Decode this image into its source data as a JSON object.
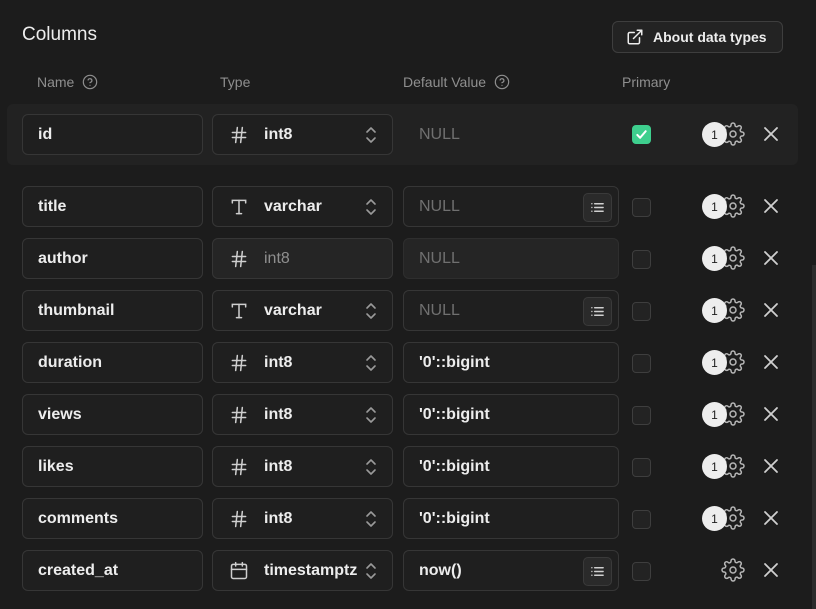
{
  "section": {
    "title": "Columns",
    "about_label": "About data types"
  },
  "headers": {
    "name": "Name",
    "type": "Type",
    "default": "Default Value",
    "primary": "Primary"
  },
  "rows": [
    {
      "name": "id",
      "type_icon": "hash-icon",
      "type": "int8",
      "selectable": true,
      "default": "NULL",
      "default_placeholder": true,
      "default_style": "plain",
      "has_list": false,
      "primary": true,
      "badge": "1"
    },
    {
      "name": "title",
      "type_icon": "text-icon",
      "type": "varchar",
      "selectable": true,
      "default": "NULL",
      "default_placeholder": true,
      "default_style": "field",
      "has_list": true,
      "primary": false,
      "badge": "1"
    },
    {
      "name": "author",
      "type_icon": "hash-icon",
      "type": "int8",
      "selectable": false,
      "default": "NULL",
      "default_placeholder": true,
      "default_style": "disabled",
      "has_list": false,
      "primary": false,
      "badge": "1"
    },
    {
      "name": "thumbnail",
      "type_icon": "text-icon",
      "type": "varchar",
      "selectable": true,
      "default": "NULL",
      "default_placeholder": true,
      "default_style": "field",
      "has_list": true,
      "primary": false,
      "badge": "1"
    },
    {
      "name": "duration",
      "type_icon": "hash-icon",
      "type": "int8",
      "selectable": true,
      "default": "'0'::bigint",
      "default_placeholder": false,
      "default_style": "field",
      "has_list": false,
      "primary": false,
      "badge": "1"
    },
    {
      "name": "views",
      "type_icon": "hash-icon",
      "type": "int8",
      "selectable": true,
      "default": "'0'::bigint",
      "default_placeholder": false,
      "default_style": "field",
      "has_list": false,
      "primary": false,
      "badge": "1"
    },
    {
      "name": "likes",
      "type_icon": "hash-icon",
      "type": "int8",
      "selectable": true,
      "default": "'0'::bigint",
      "default_placeholder": false,
      "default_style": "field",
      "has_list": false,
      "primary": false,
      "badge": "1"
    },
    {
      "name": "comments",
      "type_icon": "hash-icon",
      "type": "int8",
      "selectable": true,
      "default": "'0'::bigint",
      "default_placeholder": false,
      "default_style": "field",
      "has_list": false,
      "primary": false,
      "badge": "1"
    },
    {
      "name": "created_at",
      "type_icon": "calendar-icon",
      "type": "timestamptz",
      "selectable": true,
      "default": "now()",
      "default_placeholder": false,
      "default_style": "field",
      "has_list": true,
      "primary": false,
      "badge": ""
    }
  ],
  "colors": {
    "background": "#1c1c1c",
    "accent": "#3ecf8e",
    "text": "#ededed",
    "muted": "#8f8f8f"
  }
}
